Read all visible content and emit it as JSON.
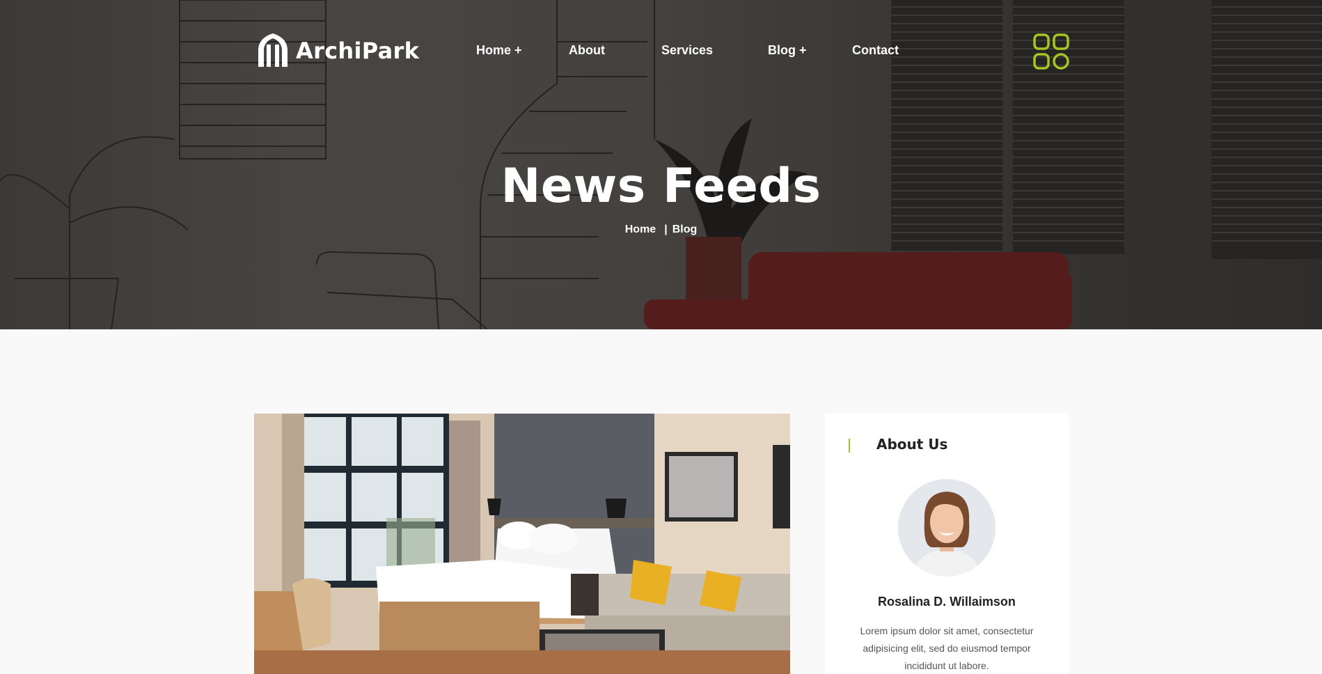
{
  "brand": {
    "name": "ArchiPark"
  },
  "nav": {
    "items": [
      {
        "label": "Home +"
      },
      {
        "label": "About"
      },
      {
        "label": "Services"
      },
      {
        "label": "Blog +"
      },
      {
        "label": "Contact"
      }
    ]
  },
  "header_actions": {
    "menu_icon": "grid-four-rounded-icon",
    "accent_color": "#a8c520"
  },
  "hero": {
    "title": "News Feeds",
    "breadcrumb": {
      "home": "Home",
      "separator": "|",
      "current": "Blog"
    }
  },
  "post": {
    "image": "hotel-room-photo"
  },
  "sidebar": {
    "about": {
      "title": "About Us",
      "avatar": "woman-portrait-avatar",
      "name": "Rosalina D. Willaimson",
      "bio": "Lorem ipsum dolor sit amet, consectetur adipisicing elit, sed do eiusmod tempor incididunt ut labore."
    }
  },
  "colors": {
    "accent": "#a8c520",
    "background": "#f9f9f9",
    "card": "#ffffff"
  }
}
